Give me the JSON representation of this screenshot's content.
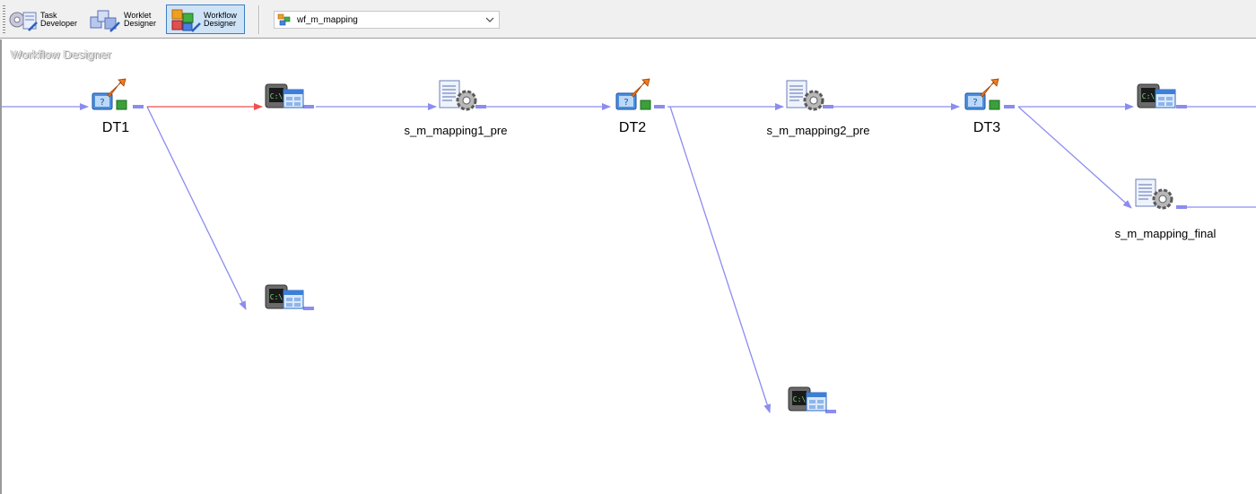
{
  "toolbar": {
    "buttons": [
      {
        "label": "Task\nDeveloper",
        "icon": "task-developer-icon",
        "active": false
      },
      {
        "label": "Worklet\nDesigner",
        "icon": "worklet-designer-icon",
        "active": false
      },
      {
        "label": "Workflow\nDesigner",
        "icon": "workflow-designer-icon",
        "active": true
      }
    ],
    "workflow_select": {
      "value": "wf_m_mapping",
      "icon": "workflow-icon"
    }
  },
  "canvas": {
    "title": "Workflow Designer",
    "nodes": [
      {
        "id": "dt1",
        "type": "decision",
        "label": "DT1"
      },
      {
        "id": "cmd1",
        "type": "command",
        "label": ""
      },
      {
        "id": "cmd2",
        "type": "command",
        "label": ""
      },
      {
        "id": "s1",
        "type": "session",
        "label": "s_m_mapping1_pre"
      },
      {
        "id": "dt2",
        "type": "decision",
        "label": "DT2"
      },
      {
        "id": "cmd3",
        "type": "command",
        "label": ""
      },
      {
        "id": "s2",
        "type": "session",
        "label": "s_m_mapping2_pre"
      },
      {
        "id": "dt3",
        "type": "decision",
        "label": "DT3"
      },
      {
        "id": "cmd4",
        "type": "command",
        "label": ""
      },
      {
        "id": "s3",
        "type": "session",
        "label": "s_m_mapping_final"
      }
    ],
    "colors": {
      "link": "#8c8cf0",
      "error_link": "#f05050",
      "active_border": "#3c7fc2"
    }
  }
}
